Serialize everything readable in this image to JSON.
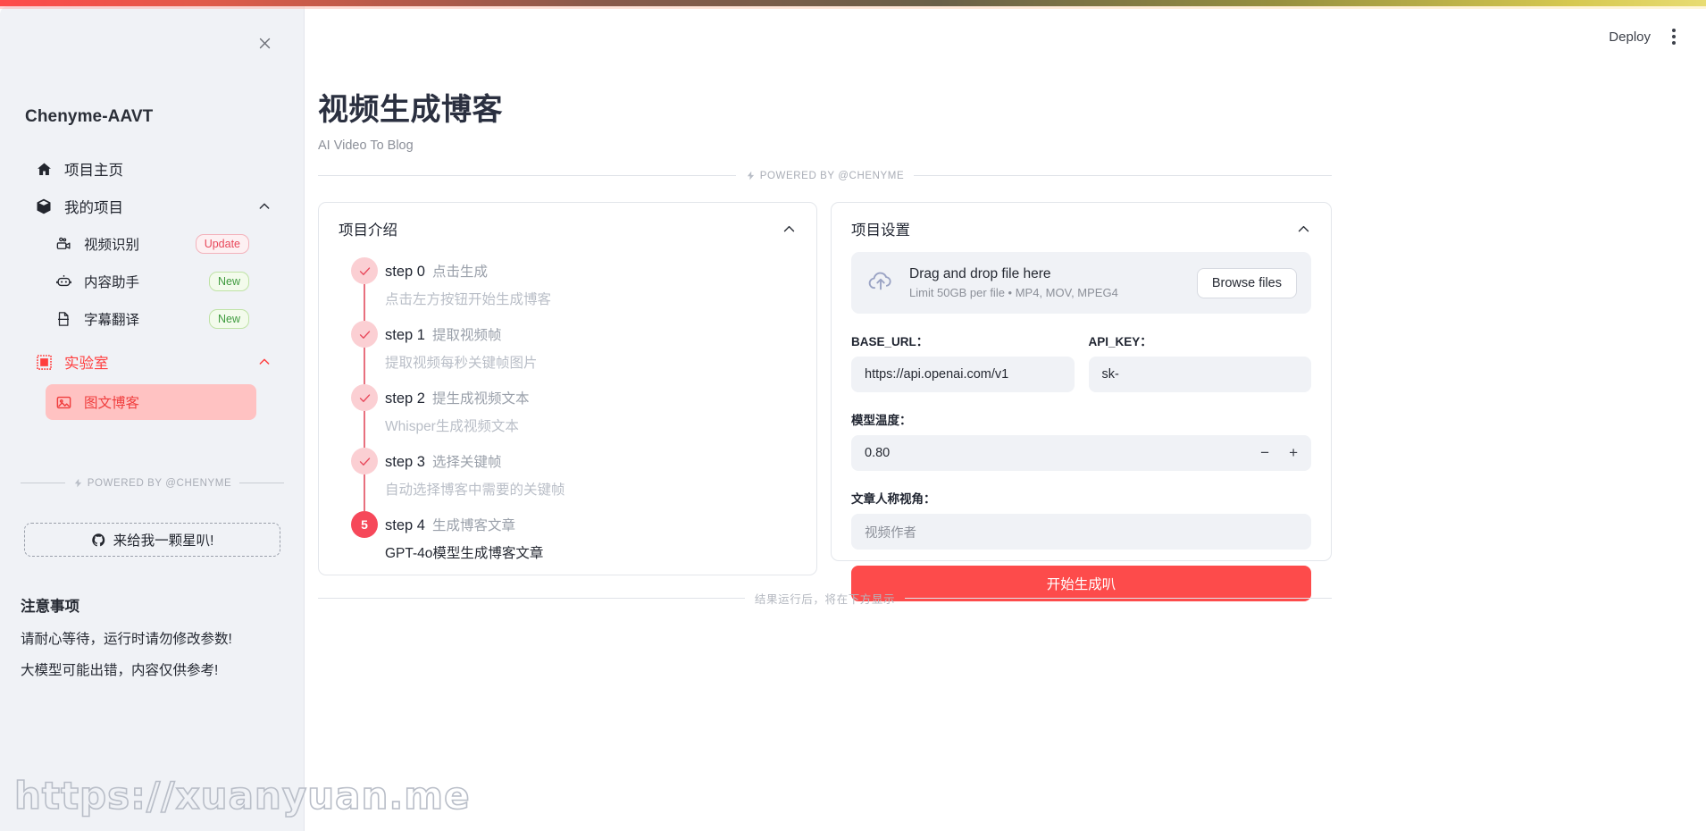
{
  "window": {
    "close_label": "✕",
    "accent_red": "#fd4b4b",
    "sidebar_bg": "#f0f2f6"
  },
  "watermark": {
    "text": "https://xuanyuan.me"
  },
  "header": {
    "deploy_label": "Deploy",
    "menu_icon": "kebab-menu-icon"
  },
  "sidebar": {
    "brand": "Chenyme-AAVT",
    "items": [
      {
        "label": "项目主页",
        "icon": "home-icon",
        "badge": null
      },
      {
        "label": "我的项目",
        "icon": "box-icon",
        "badge": null,
        "chevron": "chevron-up-icon"
      }
    ],
    "project_children": [
      {
        "label": "视频识别",
        "icon": "video-camera-icon",
        "badge": "Update",
        "badge_type": "update"
      },
      {
        "label": "内容助手",
        "icon": "robot-icon",
        "badge": "New",
        "badge_type": "new"
      },
      {
        "label": "字幕翻译",
        "icon": "document-icon",
        "badge": "New",
        "badge_type": "new"
      }
    ],
    "lab": {
      "label": "实验室",
      "icon": "stamp-icon",
      "chevron": "chevron-up-icon"
    },
    "lab_children": [
      {
        "label": "图文博客",
        "icon": "image-icon",
        "active": true
      }
    ],
    "divider_text": "POWERED BY @CHENYME",
    "star_button": "来给我一颗星叭!",
    "notes": {
      "title": "注意事项",
      "lines": [
        "请耐心等待，运行时请勿修改参数!",
        "大模型可能出错，内容仅供参考!"
      ]
    }
  },
  "main": {
    "title": "视频生成博客",
    "subtitle": "AI Video To Blog",
    "powered_divider": "POWERED BY @CHENYME",
    "result_divider": "结果运行后，将在下方显示"
  },
  "intro": {
    "title": "项目介绍",
    "chevron": "chevron-up-icon",
    "steps": [
      {
        "label": "step 0",
        "sub": "点击生成",
        "desc": "点击左方按钮开始生成博客",
        "state": "done",
        "marker": "✓"
      },
      {
        "label": "step 1",
        "sub": "提取视频帧",
        "desc": "提取视频每秒关键帧图片",
        "state": "done",
        "marker": "✓"
      },
      {
        "label": "step 2",
        "sub": "提生成视频文本",
        "desc": "Whisper生成视频文本",
        "state": "done",
        "marker": "✓"
      },
      {
        "label": "step 3",
        "sub": "选择关键帧",
        "desc": "自动选择博客中需要的关键帧",
        "state": "done",
        "marker": "✓"
      },
      {
        "label": "step 4",
        "sub": "生成博客文章",
        "desc": "GPT-4o模型生成博客文章",
        "state": "current",
        "marker": "5"
      }
    ]
  },
  "settings": {
    "title": "项目设置",
    "chevron": "chevron-up-icon",
    "dropzone": {
      "icon": "cloud-upload-icon",
      "title": "Drag and drop file here",
      "subtitle": "Limit 50GB per file • MP4, MOV, MPEG4",
      "browse_label": "Browse files"
    },
    "base_url": {
      "label": "BASE_URL：",
      "value": "https://api.openai.com/v1"
    },
    "api_key": {
      "label": "API_KEY：",
      "value": "sk-"
    },
    "temperature": {
      "label": "模型温度：",
      "value": "0.80",
      "minus": "−",
      "plus": "+"
    },
    "perspective": {
      "label": "文章人称视角：",
      "value": "视频作者"
    },
    "generate_label": "开始生成叭"
  }
}
